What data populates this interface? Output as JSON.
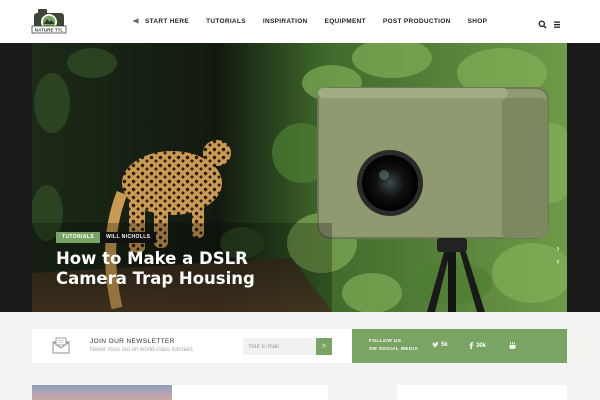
{
  "header": {
    "logo_text": "NATURE TTL",
    "nav": [
      {
        "label": "START HERE",
        "icon": "megaphone-icon"
      },
      {
        "label": "TUTORIALS"
      },
      {
        "label": "INSPIRATION"
      },
      {
        "label": "EQUIPMENT"
      },
      {
        "label": "POST PRODUCTION"
      },
      {
        "label": "SHOP"
      }
    ],
    "icons": [
      "search-icon",
      "menu-icon"
    ]
  },
  "hero": {
    "category": "TUTORIALS",
    "author": "WILL NICHOLLS",
    "title": "How to Make a DSLR Camera Trap Housing",
    "arrows": [
      "chevron-right-icon",
      "chevron-left-icon"
    ]
  },
  "newsletter": {
    "title": "JOIN OUR NEWSLETTER",
    "subtitle": "Never miss out on world-class tutorials",
    "placeholder": "Your E-mail",
    "submit": ">"
  },
  "social": {
    "follow_line1": "FOLLOW US",
    "follow_line2": "ON SOCIAL MEDIA",
    "twitter": "5k",
    "facebook": "30k",
    "youtube": ""
  },
  "colors": {
    "accent": "#7aa463",
    "dark": "#1b1b1b"
  }
}
